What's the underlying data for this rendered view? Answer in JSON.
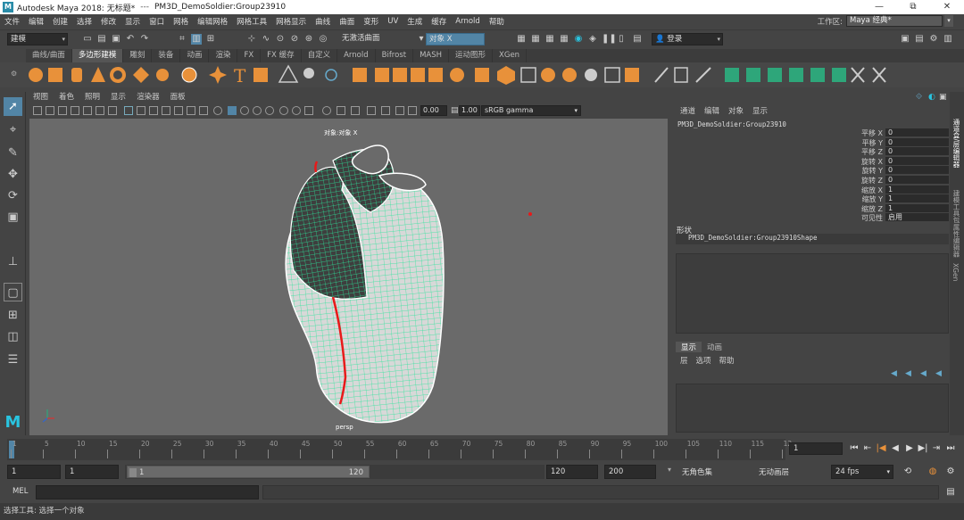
{
  "window": {
    "app_title": "Autodesk Maya 2018: 无标题*",
    "separator": "---",
    "object_path": "PM3D_DemoSoldier:Group23910",
    "controls": [
      "—",
      "⧉",
      "✕"
    ]
  },
  "menubar": {
    "items": [
      "文件",
      "编辑",
      "创建",
      "选择",
      "修改",
      "显示",
      "窗口",
      "网格",
      "编辑网格",
      "网格工具",
      "网格显示",
      "曲线",
      "曲面",
      "变形",
      "UV",
      "生成",
      "缓存",
      "Arnold",
      "帮助"
    ],
    "workspace_label": "工作区:",
    "workspace_value": "Maya 经典*"
  },
  "statusline": {
    "mode": "建模",
    "live_surface": "无激活曲面",
    "object_field": "对象 X",
    "login": "登录"
  },
  "shelf": {
    "tabs": [
      "曲线/曲面",
      "多边形建模",
      "雕刻",
      "装备",
      "动画",
      "渲染",
      "FX",
      "FX 缓存",
      "自定义",
      "Arnold",
      "Bifrost",
      "MASH",
      "运动图形",
      "XGen"
    ],
    "active_tab": 1
  },
  "panel": {
    "menu": [
      "视图",
      "着色",
      "照明",
      "显示",
      "渲染器",
      "面板"
    ],
    "exposure": "0.00",
    "gamma": "1.00",
    "color_space": "sRGB gamma",
    "hud_object": "对象:对象 X",
    "camera": "persp"
  },
  "channelbox": {
    "menu": [
      "通道",
      "编辑",
      "对象",
      "显示"
    ],
    "object": "PM3D_DemoSoldier:Group23910",
    "channels": [
      {
        "label": "平移 X",
        "value": "0"
      },
      {
        "label": "平移 Y",
        "value": "0"
      },
      {
        "label": "平移 Z",
        "value": "0"
      },
      {
        "label": "旋转 X",
        "value": "0"
      },
      {
        "label": "旋转 Y",
        "value": "0"
      },
      {
        "label": "旋转 Z",
        "value": "0"
      },
      {
        "label": "缩放 X",
        "value": "1"
      },
      {
        "label": "缩放 Y",
        "value": "1"
      },
      {
        "label": "缩放 Z",
        "value": "1"
      },
      {
        "label": "可见性",
        "value": "启用"
      }
    ],
    "shapes_label": "形状",
    "shape_name": "PM3D_DemoSoldier:Group23910Shape"
  },
  "layers": {
    "tabs": [
      "显示",
      "动画"
    ],
    "active_tab": 0,
    "menu": [
      "层",
      "选项",
      "帮助"
    ]
  },
  "side_tabs": [
    "通道盒/层编辑器",
    "建模工具包",
    "属性编辑器",
    "XGen"
  ],
  "timeline": {
    "ticks": [
      "1",
      "5",
      "10",
      "15",
      "20",
      "25",
      "30",
      "35",
      "40",
      "45",
      "50",
      "55",
      "60",
      "65",
      "70",
      "75",
      "80",
      "85",
      "90",
      "95",
      "100",
      "105",
      "110",
      "115",
      "12"
    ],
    "current_frame": "1"
  },
  "range": {
    "start": "1",
    "playback_start": "1",
    "slider_start": "1",
    "slider_end": "120",
    "playback_end": "120",
    "end": "200",
    "character_set": "无角色集",
    "anim_layer": "无动画层",
    "fps": "24 fps"
  },
  "mel": {
    "label": "MEL"
  },
  "help": {
    "text": "选择工具: 选择一个对象"
  },
  "colors": {
    "accent_blue": "#5285a6",
    "mesh_green": "#29e69a",
    "seam_red": "#e81a1a",
    "viewport_bg": "#6a6a6a"
  }
}
